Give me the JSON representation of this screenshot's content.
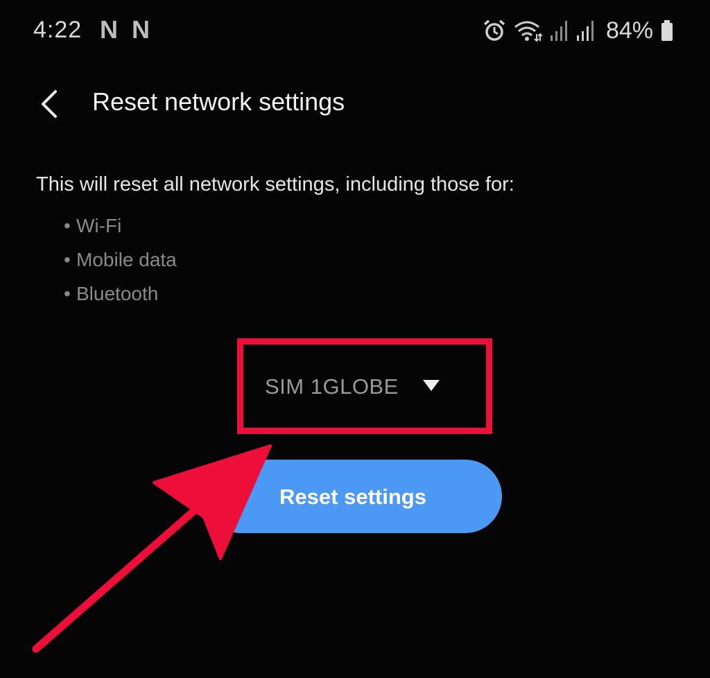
{
  "status_bar": {
    "time": "4:22",
    "notification_icons": [
      "N",
      "N"
    ],
    "battery": "84%",
    "icons": [
      "alarm-icon",
      "wifi-icon",
      "signal-icon-1",
      "signal-icon-2",
      "battery-icon"
    ]
  },
  "header": {
    "title": "Reset network settings",
    "back_icon": "chevron-left-icon"
  },
  "main": {
    "description": "This will reset all network settings, including those for:",
    "bullet": "•",
    "items": [
      "Wi-Fi",
      "Mobile data",
      "Bluetooth"
    ],
    "sim_select": {
      "value": "SIM 1GLOBE",
      "icon": "triangle-down-icon"
    },
    "reset_button_label": "Reset settings"
  },
  "annotation": {
    "highlight_color": "#ed0f3a",
    "arrow_color": "#ed0f3a"
  },
  "colors": {
    "background": "#050505",
    "accent": "#4c98f5",
    "secondary_text": "#8a8a8a"
  }
}
